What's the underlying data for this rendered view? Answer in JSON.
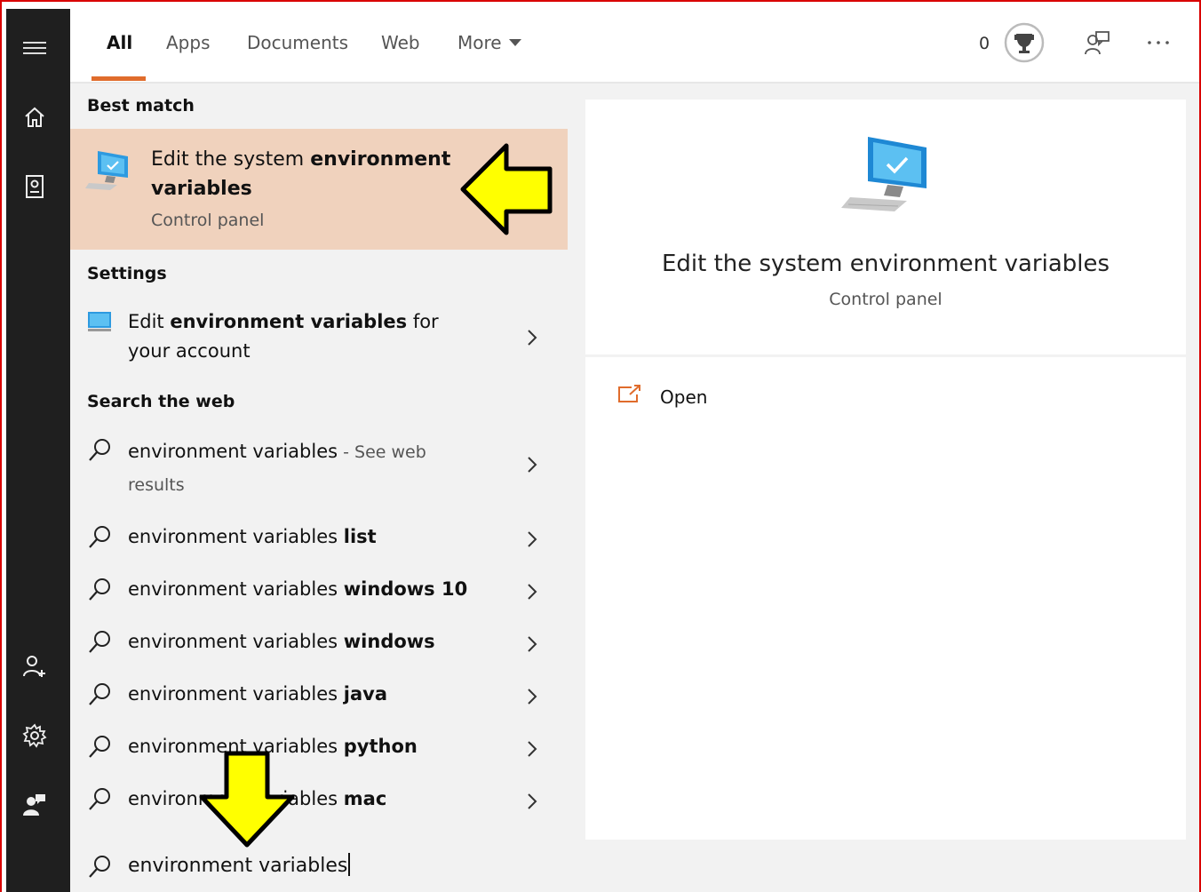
{
  "tabs": [
    {
      "label": "All",
      "active": true
    },
    {
      "label": "Apps"
    },
    {
      "label": "Documents"
    },
    {
      "label": "Web"
    },
    {
      "label": "More"
    }
  ],
  "header": {
    "points": "0"
  },
  "rail_icons": [
    "hamburger-icon",
    "home-icon",
    "notebook-icon",
    "person-add-icon",
    "gear-icon",
    "feedback-icon"
  ],
  "best_match": {
    "section": "Best match",
    "title_plain": "Edit the system ",
    "title_bold": "environment variables",
    "subtitle": "Control panel"
  },
  "settings": {
    "section": "Settings",
    "item": {
      "pre": "Edit ",
      "bold": "environment variables",
      "post": " for your account"
    }
  },
  "web": {
    "section": "Search the web",
    "first": {
      "text": "environment variables",
      "suffix": " - See web results"
    },
    "items": [
      {
        "plain": "environment variables ",
        "bold": "list"
      },
      {
        "plain": "environment variables ",
        "bold": "windows 10"
      },
      {
        "plain": "environment variables ",
        "bold": "windows"
      },
      {
        "plain": "environment variables ",
        "bold": "java"
      },
      {
        "plain": "environment variables ",
        "bold": "python"
      },
      {
        "plain": "environment variables ",
        "bold": "mac"
      }
    ]
  },
  "detail": {
    "title": "Edit the system environment variables",
    "subtitle": "Control panel",
    "open_label": "Open"
  },
  "search": {
    "value": "environment variables"
  },
  "colors": {
    "accent": "#e06c2c",
    "highlight": "#f0d2bd",
    "arrow": "#ffff00",
    "frame": "#d90000"
  }
}
